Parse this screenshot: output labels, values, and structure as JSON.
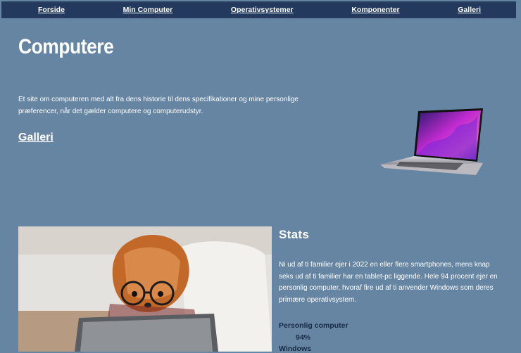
{
  "nav": {
    "items": [
      {
        "label": "Forside"
      },
      {
        "label": "Min Computer"
      },
      {
        "label": "Operativsystemer"
      },
      {
        "label": "Komponenter"
      },
      {
        "label": "Galleri"
      }
    ]
  },
  "header": {
    "title": "Computere",
    "intro": "Et site om computeren med alt fra dens historie til dens specifikationer og mine personlige præferencer, når det gælder computere og computerudstyr.",
    "gallery_link": "Galleri"
  },
  "stats": {
    "title": "Stats",
    "text": "Ni ud af ti familier ejer i 2022 en eller flere smartphones, mens knap seks ud af ti familier har en tablet-pc liggende. Hele 94 procent ejer en personlig computer, hvoraf fire ud af ti anvender Windows som deres primære operativsystem.",
    "items": [
      {
        "label": "Personlig computer",
        "value": "94%"
      },
      {
        "label": "Windows"
      }
    ]
  },
  "colors": {
    "background": "#6585a3",
    "nav_background": "#233a5e",
    "stat_text": "#172a45"
  },
  "images": {
    "laptop": "laptop-image",
    "photo": "dog-with-glasses-using-tablet-photo"
  }
}
